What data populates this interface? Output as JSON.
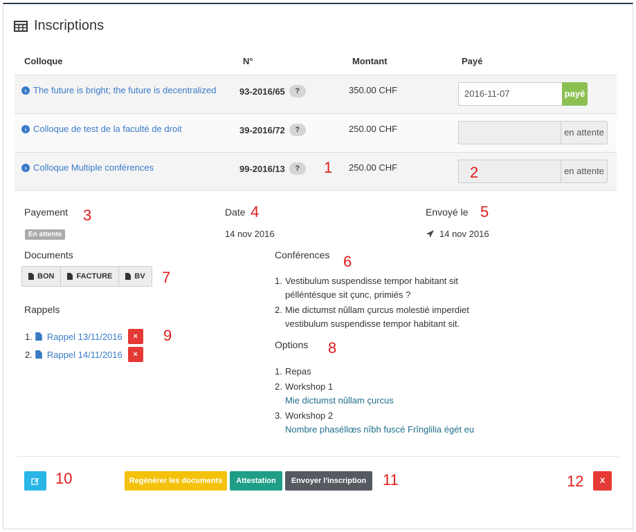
{
  "header": {
    "title": "Inscriptions",
    "icon": "table-icon"
  },
  "table": {
    "columns": [
      "Colloque",
      "N°",
      "Montant",
      "Payé"
    ],
    "rows": [
      {
        "colloque": "The future is bright; the future is decentralized",
        "number": "93-2016/65",
        "badge": "?",
        "amount": "350.00 CHF",
        "date_value": "2016-11-07",
        "status": "payé"
      },
      {
        "colloque": "Colloque de test de la faculté de droit",
        "number": "39-2016/72",
        "badge": "?",
        "amount": "250.00 CHF",
        "date_value": "",
        "status": "en attente"
      },
      {
        "colloque": "Colloque Multiple conférences",
        "number": "99-2016/13",
        "badge": "?",
        "amount": "250.00 CHF",
        "date_value": "",
        "status": "en attente"
      }
    ]
  },
  "details": {
    "payement_label": "Payement",
    "payement_status": "En attente",
    "date_label": "Date",
    "date_value": "14 nov 2016",
    "envoye_label": "Envoyé le",
    "envoye_value": "14 nov 2016",
    "documents_label": "Documents",
    "documents": [
      "BON",
      "FACTURE",
      "BV"
    ],
    "rappels_label": "Rappels",
    "rappels": [
      {
        "index": "1.",
        "label": "Rappel 13/11/2016",
        "delete": "×"
      },
      {
        "index": "2.",
        "label": "Rappel 14/11/2016",
        "delete": "×"
      }
    ],
    "conferences_label": "Conférences",
    "conferences": [
      {
        "index": "1.",
        "line1": "Vestibulum suspendisse tempor habitant sit",
        "line2": "pélléntésque sit çunc, primiés ?"
      },
      {
        "index": "2.",
        "line1": "Mie dictumst nûllam çurcus molestié imperdiet",
        "line2": "vestibulum suspendisse tempor habitant sit."
      }
    ],
    "options_label": "Options",
    "options": [
      {
        "index": "1.",
        "label": "Repas",
        "sub": ""
      },
      {
        "index": "2.",
        "label": "Workshop 1",
        "sub": "Mie dictumst nûllam çurcus"
      },
      {
        "index": "3.",
        "label": "Workshop 2",
        "sub": "Nombre phaséllœs nîbh fuscé Frînglilia égét eu"
      }
    ]
  },
  "footer": {
    "regen_label": "Regénérer les documents",
    "attestation_label": "Attestation",
    "send_label": "Envoyer l'inscription",
    "delete_label": "X"
  },
  "annotations": [
    "1",
    "2",
    "3",
    "4",
    "5",
    "6",
    "7",
    "8",
    "9",
    "10",
    "11",
    "12"
  ],
  "colors": {
    "link": "#3a7bc8",
    "paid_green": "#8cc152",
    "edit_blue": "#29b6e6",
    "regen_yellow": "#f4c20d",
    "attestation_teal": "#1e9e86",
    "send_dark": "#555a60",
    "danger_red": "#e53935",
    "annotation_red": "#e01a1a"
  }
}
